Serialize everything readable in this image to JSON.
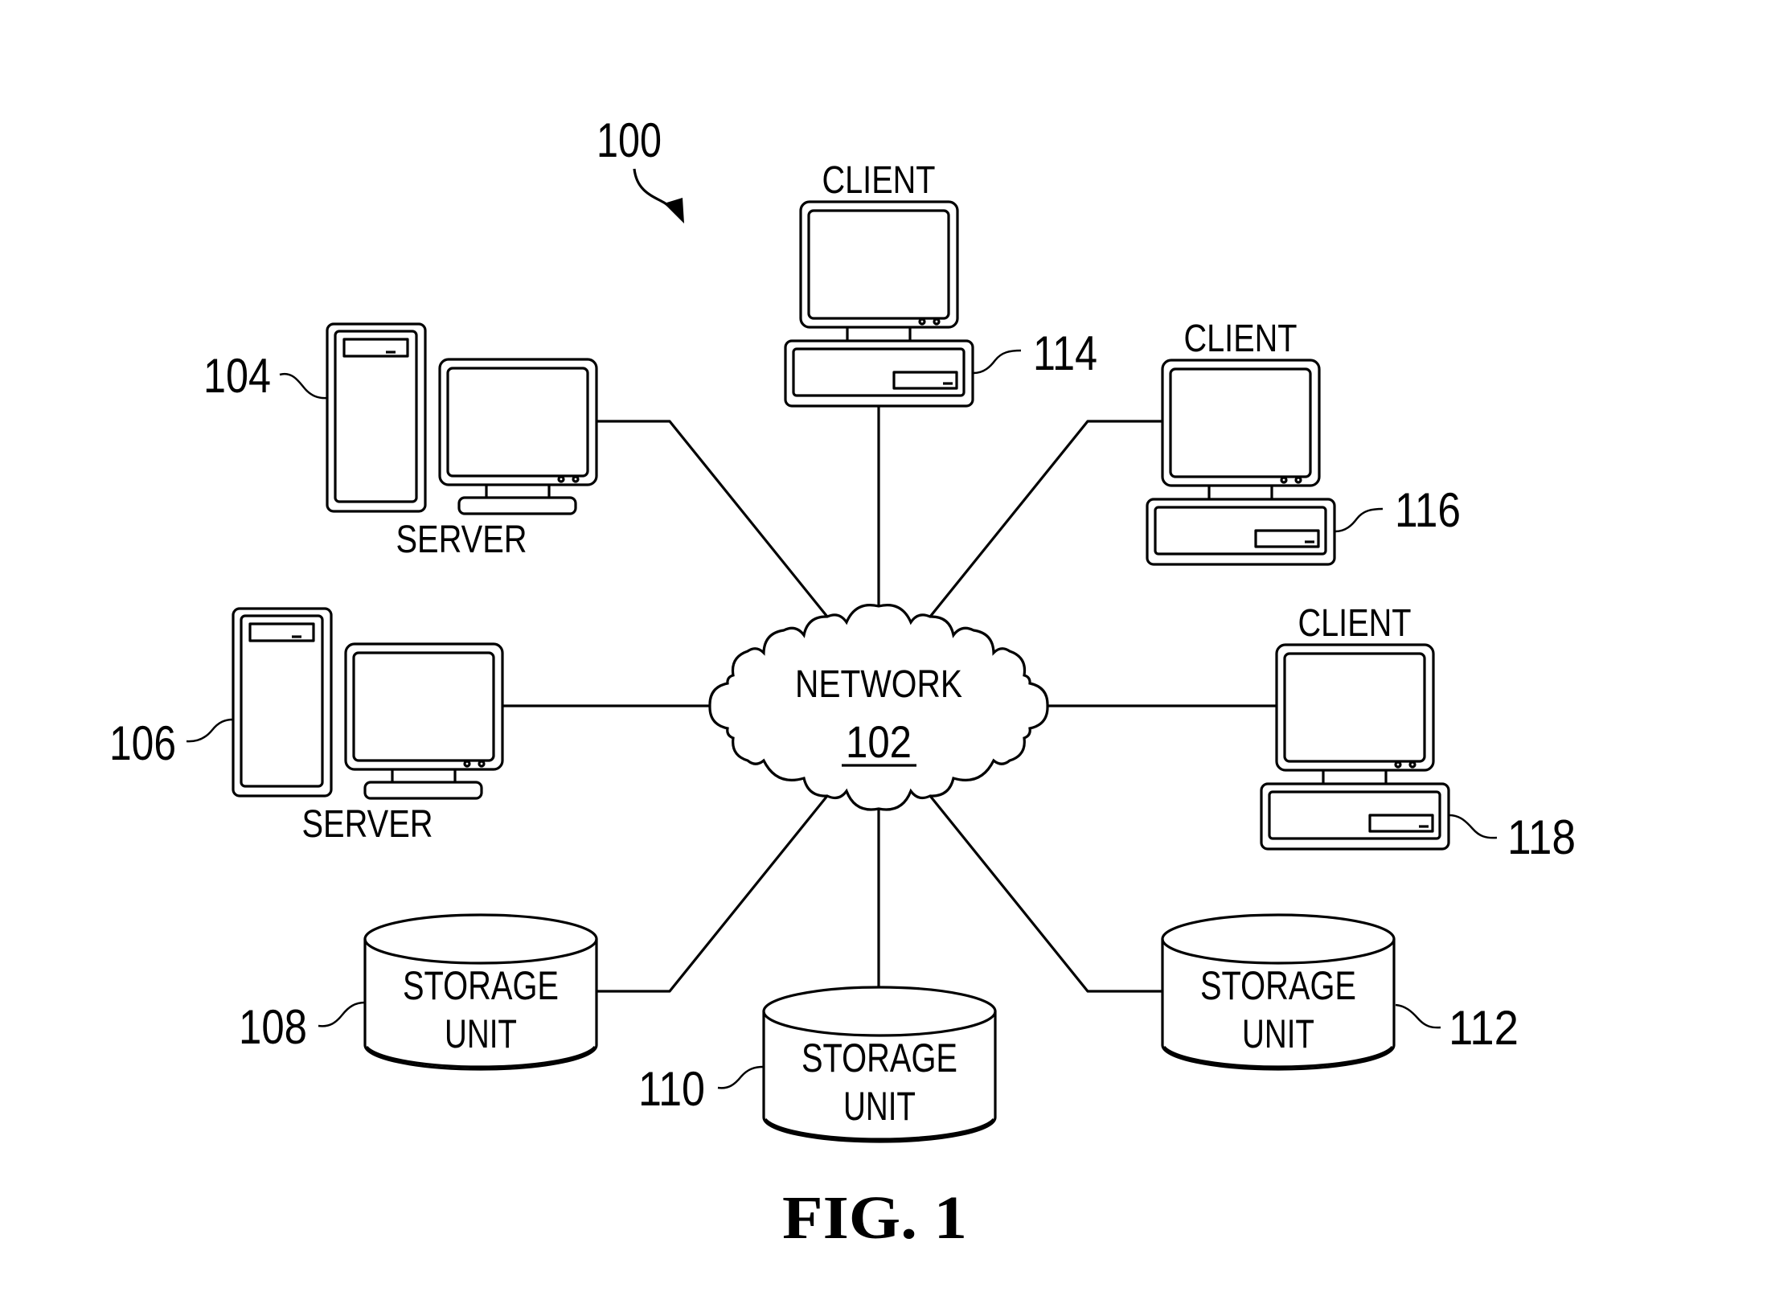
{
  "figure": {
    "reference": "100",
    "caption": "FIG. 1"
  },
  "network": {
    "label": "NETWORK",
    "reference": "102"
  },
  "servers": [
    {
      "id": "server-104",
      "label": "SERVER",
      "reference": "104"
    },
    {
      "id": "server-106",
      "label": "SERVER",
      "reference": "106"
    }
  ],
  "storage_units": [
    {
      "id": "storage-108",
      "label_line1": "STORAGE",
      "label_line2": "UNIT",
      "reference": "108"
    },
    {
      "id": "storage-110",
      "label_line1": "STORAGE",
      "label_line2": "UNIT",
      "reference": "110"
    },
    {
      "id": "storage-112",
      "label_line1": "STORAGE",
      "label_line2": "UNIT",
      "reference": "112"
    }
  ],
  "clients": [
    {
      "id": "client-114",
      "label": "CLIENT",
      "reference": "114"
    },
    {
      "id": "client-116",
      "label": "CLIENT",
      "reference": "116"
    },
    {
      "id": "client-118",
      "label": "CLIENT",
      "reference": "118"
    }
  ],
  "connections": [
    {
      "from": "network-102",
      "to": "server-104"
    },
    {
      "from": "network-102",
      "to": "server-106"
    },
    {
      "from": "network-102",
      "to": "storage-108"
    },
    {
      "from": "network-102",
      "to": "storage-110"
    },
    {
      "from": "network-102",
      "to": "storage-112"
    },
    {
      "from": "network-102",
      "to": "client-114"
    },
    {
      "from": "network-102",
      "to": "client-116"
    },
    {
      "from": "network-102",
      "to": "client-118"
    }
  ],
  "colors": {
    "line": "#000000",
    "background": "#ffffff"
  }
}
